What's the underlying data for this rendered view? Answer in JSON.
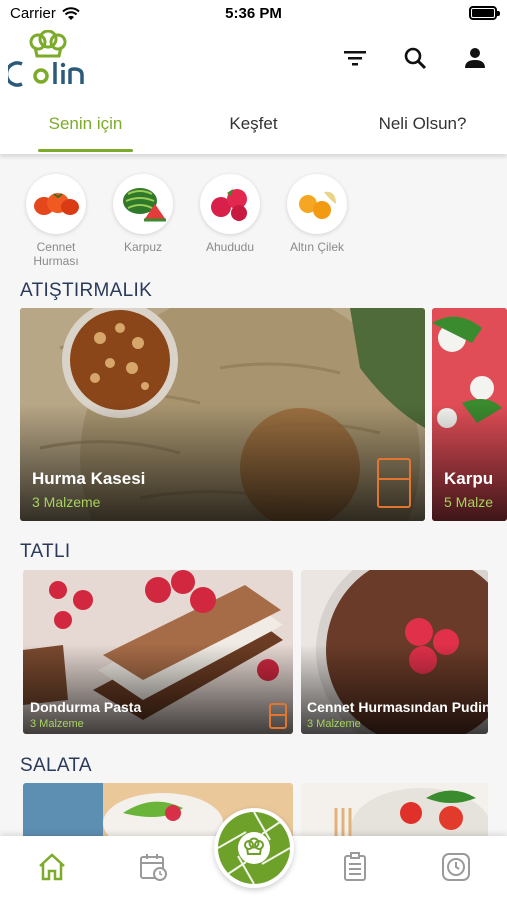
{
  "status_bar": {
    "carrier": "Carrier",
    "time": "5:36 PM"
  },
  "header": {
    "logo_text": "Culin",
    "icons": [
      "filter-icon",
      "search-icon",
      "profile-icon"
    ]
  },
  "tabs": [
    {
      "label": "Senin için",
      "active": true
    },
    {
      "label": "Keşfet",
      "active": false
    },
    {
      "label": "Neli Olsun?",
      "active": false
    }
  ],
  "fruits": [
    {
      "label": "Cennet Hurması"
    },
    {
      "label": "Karpuz"
    },
    {
      "label": "Ahududu"
    },
    {
      "label": "Altın Çilek"
    }
  ],
  "sections": [
    {
      "title": "ATIŞTIRMALIK",
      "cards": [
        {
          "title": "Hurma Kasesi",
          "subtitle": "3 Malzeme"
        },
        {
          "title": "Karpu",
          "subtitle": "5 Malze"
        }
      ]
    },
    {
      "title": "TATLI",
      "cards": [
        {
          "title": "Dondurma Pasta",
          "subtitle": "3 Malzeme"
        },
        {
          "title": "Cennet Hurmasından Puding",
          "subtitle": "3 Malzeme"
        }
      ]
    },
    {
      "title": "SALATA",
      "cards": []
    }
  ],
  "bottom_nav": [
    "home-icon",
    "calendar-icon",
    "chef-hat-icon",
    "list-icon",
    "history-icon"
  ],
  "colors": {
    "accent": "#7cab2a",
    "section_title": "#2b3a5a",
    "fridge": "#e0762f",
    "subtitle": "#a7d35d"
  }
}
